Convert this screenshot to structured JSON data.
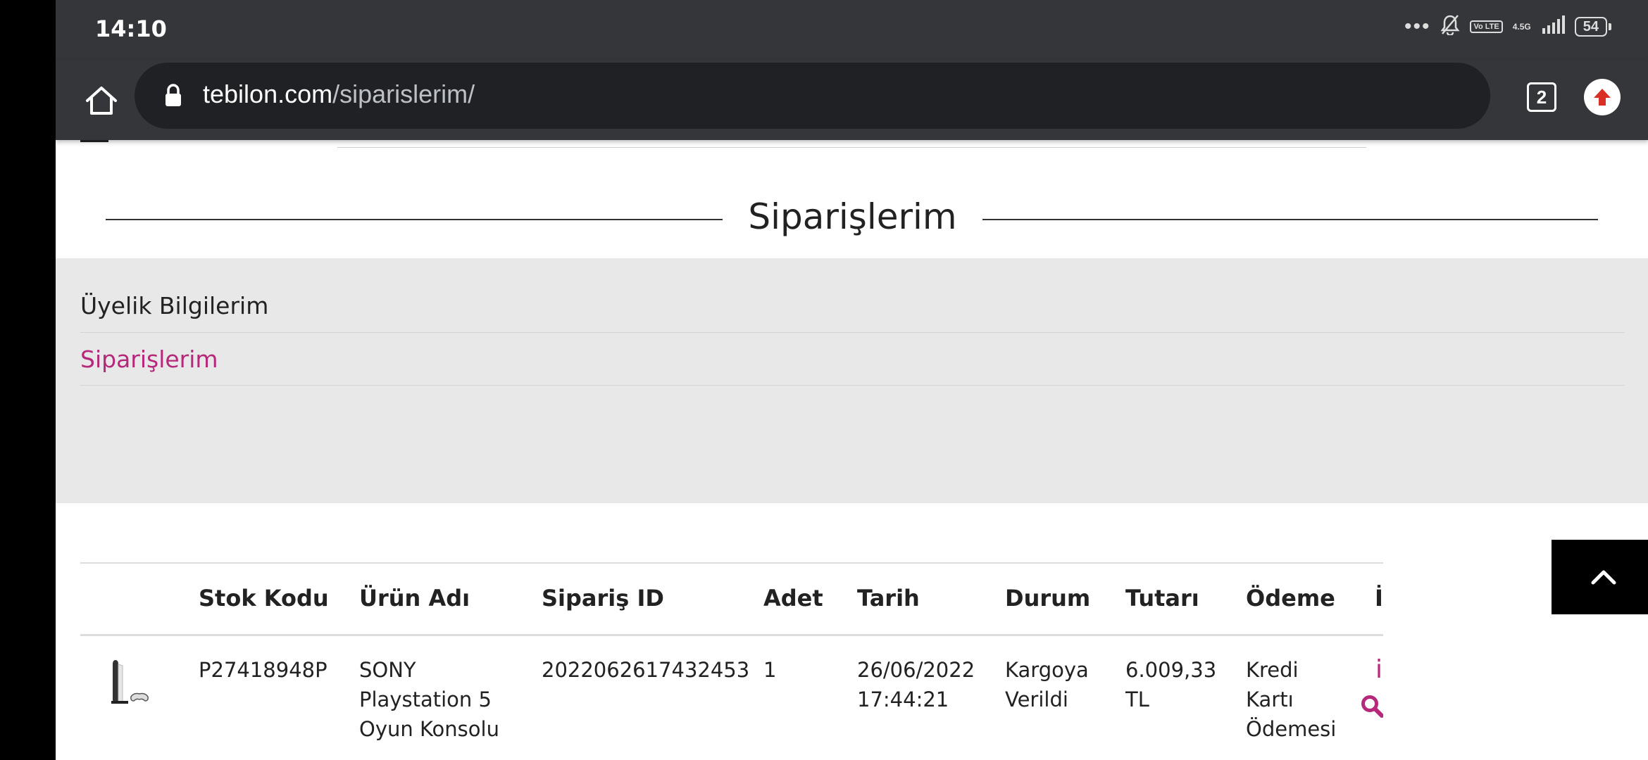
{
  "status_bar": {
    "time": "14:10",
    "dots": "•••",
    "volte": "Vo LTE",
    "network": "4.5G",
    "battery": "54"
  },
  "browser": {
    "url_domain": "tebilon.com",
    "url_path": "/siparislerim/",
    "tab_count": "2",
    "icons": [
      "home-icon",
      "lock-icon",
      "tabs-icon",
      "update-icon"
    ]
  },
  "page": {
    "title": "Siparişlerim"
  },
  "account_menu": {
    "items": [
      {
        "label": "Üyelik Bilgilerim",
        "active": false
      },
      {
        "label": "Siparişlerim",
        "active": true
      }
    ],
    "active_color": "#b5287a"
  },
  "orders": {
    "columns": [
      "",
      "Stok Kodu",
      "Ürün Adı",
      "Sipariş ID",
      "Adet",
      "Tarih",
      "Durum",
      "Tutarı",
      "Ödeme",
      "İ"
    ],
    "rows": [
      {
        "image": "playstation-5-thumbnail",
        "stock_code": "P27418948P",
        "product_name": "SONY Playstation 5 Oyun Konsolu",
        "order_id": "2022062617432453",
        "quantity": "1",
        "date": "26/06/2022 17:44:21",
        "status": "Kargoya Verildi",
        "total": "6.009,33 TL",
        "payment": "Kredi Kartı Ödemesi",
        "action_label": "ia",
        "action_icon": "search-icon"
      }
    ]
  },
  "scroll_top": {
    "icon": "chevron-up-icon"
  }
}
